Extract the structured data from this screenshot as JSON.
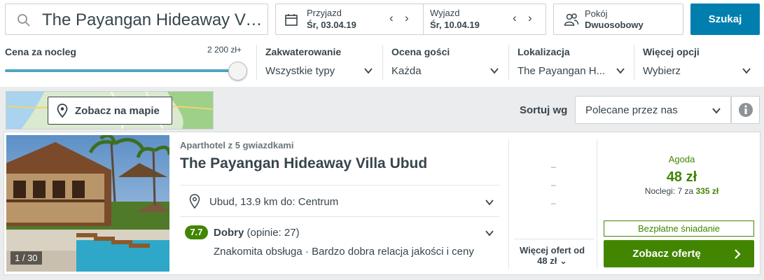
{
  "search": {
    "value": "The Payangan Hideaway Villa Ubud"
  },
  "dates": {
    "checkin_label": "Przyjazd",
    "checkin_value": "Śr, 03.04.19",
    "checkout_label": "Wyjazd",
    "checkout_value": "Śr, 10.04.19"
  },
  "room": {
    "label": "Pokój",
    "value": "Dwuosobowy"
  },
  "search_button": "Szukaj",
  "filters": {
    "price_label": "Cena za nocleg",
    "price_max": "2 200 zł+",
    "price_slider_fraction": 1.0,
    "accommodation_label": "Zakwaterowanie",
    "accommodation_value": "Wszystkie typy",
    "rating_label": "Ocena gości",
    "rating_value": "Każda",
    "location_label": "Lokalizacja",
    "location_value": "The Payangan H...",
    "more_label": "Więcej opcji",
    "more_value": "Wybierz"
  },
  "map_button": "Zobacz na mapie",
  "sort": {
    "label": "Sortuj wg",
    "value": "Polecane przez nas"
  },
  "result": {
    "photo_counter": "1 / 30",
    "type": "Aparthotel z 5 gwiazdkami",
    "name": "The Payangan Hideaway Villa Ubud",
    "location": "Ubud, 13.9 km do: Centrum",
    "rating_score": "7.7",
    "rating_word": "Dobry",
    "rating_count": "(opinie: 27)",
    "highlights": "Znakomita obsługa · Bardzo dobra relacja jakości i ceny",
    "alt_prices": [
      "–",
      "–",
      "–"
    ],
    "more_offers_line1": "Więcej ofert od",
    "more_offers_line2": "48 zł",
    "provider": "Agoda",
    "price": "48 zł",
    "nights_prefix": "Noclegi: 7 za",
    "nights_total": "335 zł",
    "breakfast": "Bezpłatne śniadanie",
    "offer_button": "Zobacz ofertę"
  },
  "colors": {
    "accent_blue": "#007faf",
    "deal_green": "#428500",
    "text": "#37454d"
  }
}
